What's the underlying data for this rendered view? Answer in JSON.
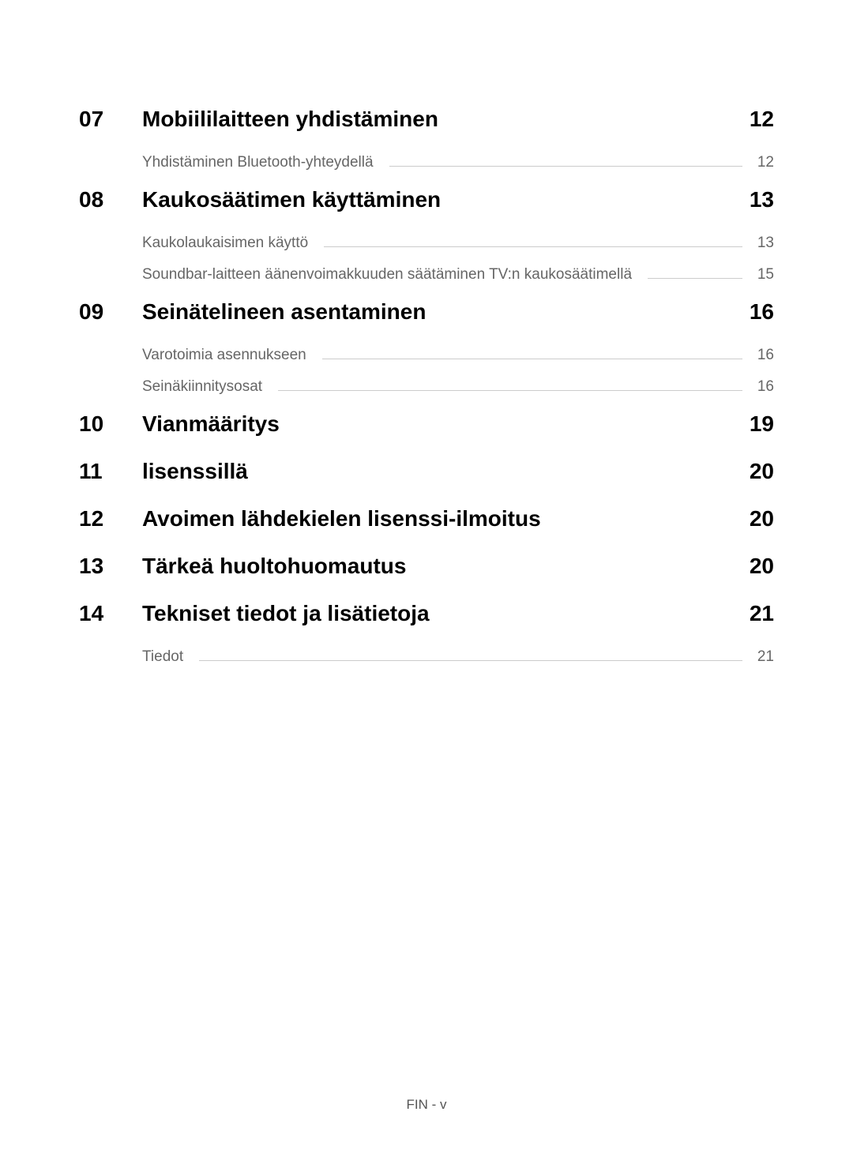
{
  "toc": [
    {
      "number": "07",
      "title": "Mobiililaitteen yhdistäminen",
      "page": "12",
      "subs": [
        {
          "title": "Yhdistäminen Bluetooth-yhteydellä",
          "page": "12"
        }
      ]
    },
    {
      "number": "08",
      "title": "Kaukosäätimen käyttäminen",
      "page": "13",
      "subs": [
        {
          "title": "Kaukolaukaisimen käyttö",
          "page": "13"
        },
        {
          "title": "Soundbar-laitteen äänenvoimakkuuden säätäminen TV:n kaukosäätimellä",
          "page": "15"
        }
      ]
    },
    {
      "number": "09",
      "title": "Seinätelineen asentaminen",
      "page": "16",
      "subs": [
        {
          "title": "Varotoimia asennukseen",
          "page": "16"
        },
        {
          "title": "Seinäkiinnitysosat",
          "page": "16"
        }
      ]
    },
    {
      "number": "10",
      "title": "Vianmääritys",
      "page": "19",
      "subs": []
    },
    {
      "number": "11",
      "title": "lisenssillä",
      "page": "20",
      "subs": []
    },
    {
      "number": "12",
      "title": "Avoimen lähdekielen lisenssi-ilmoitus",
      "page": "20",
      "subs": []
    },
    {
      "number": "13",
      "title": "Tärkeä huoltohuomautus",
      "page": "20",
      "subs": []
    },
    {
      "number": "14",
      "title": "Tekniset tiedot ja lisätietoja",
      "page": "21",
      "subs": [
        {
          "title": "Tiedot",
          "page": "21"
        }
      ]
    }
  ],
  "footer": "FIN - v"
}
